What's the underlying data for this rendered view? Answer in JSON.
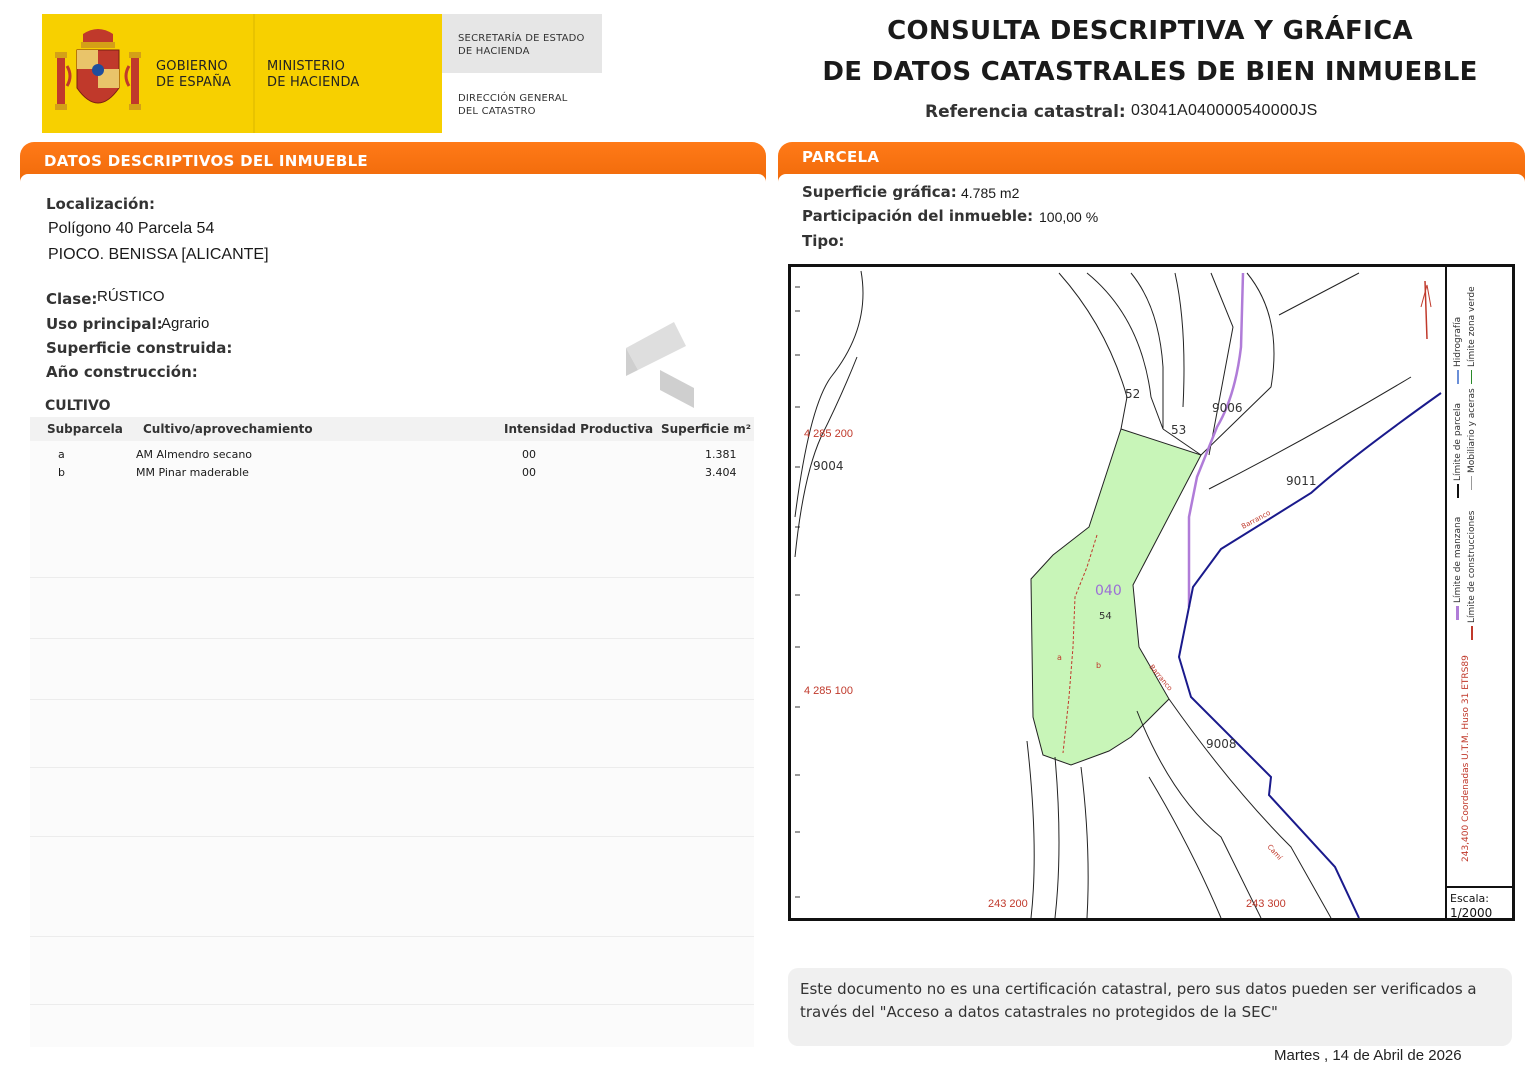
{
  "header": {
    "gov_line1": "GOBIERNO",
    "gov_line2": "DE ESPAÑA",
    "min_line1": "MINISTERIO",
    "min_line2": "DE HACIENDA",
    "sec_line1": "SECRETARÍA DE ESTADO",
    "sec_line2": "DE HACIENDA",
    "dg_line1": "DIRECCIÓN GENERAL",
    "dg_line2": "DEL CATASTRO",
    "title_line1": "CONSULTA DESCRIPTIVA Y GRÁFICA",
    "title_line2": "DE DATOS CATASTRALES DE BIEN INMUEBLE",
    "ref_label": "Referencia catastral:",
    "ref_value": "03041A040000540000JS"
  },
  "descriptive": {
    "section_title": "DATOS DESCRIPTIVOS DEL INMUEBLE",
    "localizacion_label": "Localización:",
    "localizacion_line1": "Polígono 40 Parcela 54",
    "localizacion_line2": "PIOCO. BENISSA [ALICANTE]",
    "clase_label": "Clase:",
    "clase_value": "RÚSTICO",
    "uso_label": "Uso principal:",
    "uso_value": "Agrario",
    "superficie_label": "Superficie construida:",
    "ano_label": "Año construcción:"
  },
  "cultivo": {
    "title": "CULTIVO",
    "headers": {
      "subparcela": "Subparcela",
      "cultivo": "Cultivo/aprovechamiento",
      "intensidad": "Intensidad Productiva",
      "superficie": "Superficie m²"
    },
    "rows": [
      {
        "subparcela": "a",
        "cultivo": "AM Almendro secano",
        "intensidad": "00",
        "superficie": "1.381"
      },
      {
        "subparcela": "b",
        "cultivo": "MM Pinar maderable",
        "intensidad": "00",
        "superficie": "3.404"
      }
    ]
  },
  "parcela": {
    "section_title": "PARCELA",
    "sup_label": "Superficie gráfica:",
    "sup_value": "4.785 m2",
    "part_label": "Participación del inmueble:",
    "part_value": "100,00 %",
    "tipo_label": "Tipo:"
  },
  "map": {
    "labels": {
      "n52": "52",
      "n53": "53",
      "n9006": "9006",
      "n9004": "9004",
      "n9011": "9011",
      "n9008": "9008",
      "poligono": "040",
      "parcela": "54",
      "sub_a": "a",
      "sub_b": "b",
      "coord_y1": "4 285 200",
      "coord_y2": "4 285 100",
      "coord_x1": "243 200",
      "coord_x2": "243 300",
      "road1": "Barranco",
      "road2": "Barranco",
      "road3": "Camí"
    },
    "legend": {
      "manzana": "Límite de manzana",
      "construcciones": "Límite de construcciones",
      "parcela": "Límite de parcela",
      "mobiliario": "Mobiliario y aceras",
      "hidrografia": "Hidrografía",
      "zona_verde": "Límite zona verde",
      "coords": "243,400 Coordenadas U.T.M. Huso 31 ETRS89"
    },
    "scale_label": "Escala:",
    "scale_value": "1/2000",
    "colors": {
      "parcel_fill": "#c8f5b8",
      "road_blue": "#1a1a8c",
      "hydro_purple": "#b07cd8",
      "coord_red": "#c0392b"
    }
  },
  "footer": {
    "notice": "Este documento no es una certificación catastral, pero sus datos pueden ser verificados a través del \"Acceso a datos catastrales no protegidos de la SEC\"",
    "date": "Martes , 14 de Abril de 2026"
  }
}
